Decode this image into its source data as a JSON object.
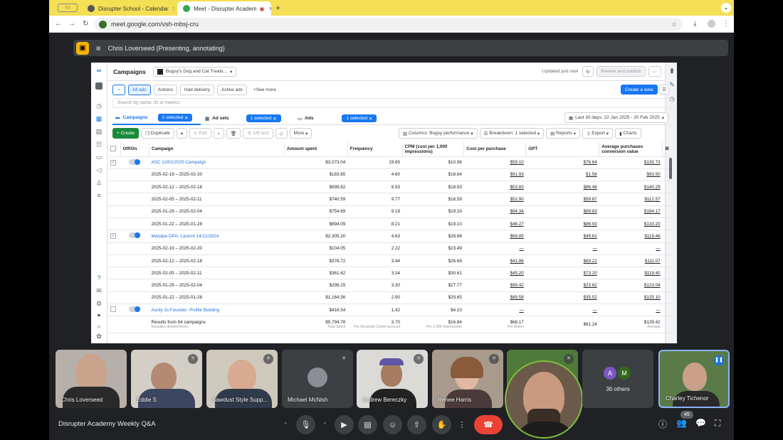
{
  "browser": {
    "tabs": [
      {
        "label": "Disrupter School - Calendar"
      },
      {
        "label": "Meet - Disrupter Academ"
      }
    ],
    "url": "meet.google.com/vsh-mbsj-cru"
  },
  "meet": {
    "presenter_label": "Chris Loverseed (Presenting, annotating)",
    "meeting_title": "Disrupter Academy Weekly Q&A",
    "participant_count": "45",
    "others_label": "36 others",
    "others_initials": [
      "A",
      "M"
    ],
    "tiles": [
      {
        "name": "Chris Loverseed"
      },
      {
        "name": "Eddie S"
      },
      {
        "name": "Sawdust Style Supp..."
      },
      {
        "name": "Michael McNish"
      },
      {
        "name": "Andrew Bereczky"
      },
      {
        "name": "Renee Harris"
      },
      {
        "name": "Charley Tichenor"
      }
    ]
  },
  "ads": {
    "title": "Campaigns",
    "account": "Bugsy's Dog and Cat Treats...",
    "updated": "Updated just now",
    "review_publish": "Review and publish",
    "filters": [
      "All ads",
      "Actions",
      "Had delivery",
      "Active ads",
      "See more"
    ],
    "create_view": "Create a view",
    "search_placeholder": "Search by name, ID or metrics",
    "levels": [
      {
        "label": "Campaigns",
        "badge": "2 selected"
      },
      {
        "label": "Ad sets",
        "badge": "1 selected"
      },
      {
        "label": "Ads",
        "badge": "1 selected"
      }
    ],
    "date_range": "Last 30 days: 22 Jan 2025 - 20 Feb 2025",
    "toolbar": {
      "create": "Create",
      "duplicate": "Duplicate",
      "edit": "Edit",
      "ab_test": "A/B test",
      "more": "More",
      "columns": "Columns: Bugsy performance",
      "breakdown": "Breakdown: 1 selected",
      "reports": "Reports",
      "export": "Export",
      "charts": "Charts"
    },
    "columns": [
      "Off/On",
      "Campaign",
      "Amount spent",
      "Frequency",
      "CPM (cost per 1,000 impressions)",
      "Cost per purchase",
      "GPT",
      "Average purchases conversion value"
    ],
    "rows": [
      {
        "type": "campaign",
        "name": "ASC 12/01/2025 Campaign",
        "spent": "$3,073.04",
        "freq": "19.65",
        "cpm": "$10.96",
        "cpp": "$59.10",
        "gpt": "$76.64",
        "avg": "$135.73"
      },
      {
        "type": "sub",
        "name": "2025-02-19 – 2025-02-20",
        "spent": "$183.85",
        "freq": "4.60",
        "cpm": "$18.64",
        "cpp": "$91.93",
        "gpt": "$1.58",
        "avg": "$93.50"
      },
      {
        "type": "sub",
        "name": "2025-02-12 – 2025-02-18",
        "spent": "$699.82",
        "freq": "9.93",
        "cpm": "$18.93",
        "cpp": "$53.83",
        "gpt": "$86.46",
        "avg": "$140.29"
      },
      {
        "type": "sub",
        "name": "2025-02-05 – 2025-02-11",
        "spent": "$740.59",
        "freq": "9.77",
        "cpm": "$18.59",
        "cpp": "$52.90",
        "gpt": "$59.67",
        "avg": "$112.57"
      },
      {
        "type": "sub",
        "name": "2025-01-29 – 2025-02-04",
        "spent": "$754.69",
        "freq": "9.19",
        "cpm": "$19.33",
        "cpp": "$94.34",
        "gpt": "$89.83",
        "avg": "$184.17"
      },
      {
        "type": "sub",
        "name": "2025-01-22 – 2025-01-28",
        "spent": "$694.09",
        "freq": "8.21",
        "cpm": "$19.10",
        "cpp": "$46.27",
        "gpt": "$86.93",
        "avg": "$133.20"
      },
      {
        "type": "campaign",
        "name": "Marpipe DPA- Launch 14/12/2024",
        "spent": "$2,305.20",
        "freq": "4.63",
        "cpm": "$28.68",
        "cpp": "$69.85",
        "gpt": "$49.61",
        "avg": "$119.46"
      },
      {
        "type": "sub",
        "name": "2025-02-19 – 2025-02-20",
        "spent": "$104.05",
        "freq": "2.22",
        "cpm": "$23.49",
        "cpp": "—",
        "gpt": "—",
        "avg": "—"
      },
      {
        "type": "sub",
        "name": "2025-02-12 – 2025-02-18",
        "spent": "$376.72",
        "freq": "3.44",
        "cpm": "$26.69",
        "cpp": "$41.86",
        "gpt": "$69.21",
        "avg": "$111.07"
      },
      {
        "type": "sub",
        "name": "2025-02-05 – 2025-02-11",
        "spent": "$361.62",
        "freq": "3.34",
        "cpm": "$30.61",
        "cpp": "$45.20",
        "gpt": "$73.20",
        "avg": "$118.40"
      },
      {
        "type": "sub",
        "name": "2025-01-29 – 2025-02-04",
        "spent": "$298.25",
        "freq": "3.30",
        "cpm": "$27.77",
        "cpp": "$99.42",
        "gpt": "$23.62",
        "avg": "$123.04"
      },
      {
        "type": "sub",
        "name": "2025-01-22 – 2025-01-28",
        "spent": "$1,164.56",
        "freq": "2.90",
        "cpm": "$29.65",
        "cpp": "$89.58",
        "gpt": "$35.52",
        "avg": "$125.10"
      },
      {
        "type": "campaign",
        "name": "Aunty Jo Founder- Profile Building",
        "spent": "$416.54",
        "freq": "1.42",
        "cpm": "$4.10",
        "cpp": "—",
        "gpt": "—",
        "avg": "—"
      }
    ],
    "footer": {
      "label": "Results from 84 campaigns",
      "sublabel": "Excludes deleted items",
      "spent": "$5,794.78",
      "spent_sub": "Total Spent",
      "freq": "3.70",
      "freq_sub": "Per Accounts Centre account",
      "cpm": "$16.84",
      "cpm_sub": "Per 1,000 Impressions",
      "cpp": "$68.17",
      "cpp_sub": "Per Action",
      "gpt": "$61.24",
      "avg": "$129.42",
      "avg_sub": "Average"
    }
  },
  "colors": {
    "tabbar": "#f5df54",
    "meet_bg": "#202124",
    "hangup": "#ea4335",
    "fb_blue": "#1877f2"
  }
}
